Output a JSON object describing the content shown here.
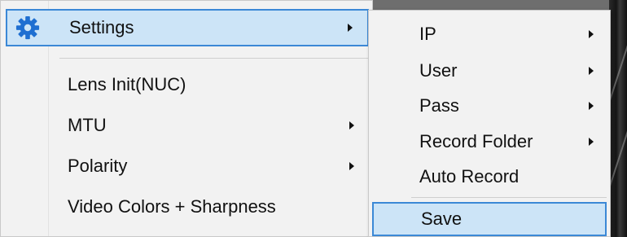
{
  "main_menu": {
    "items": [
      {
        "label": "Settings",
        "icon": "gear-icon",
        "has_submenu": true,
        "highlighted": true
      },
      {
        "label": "Lens Init(NUC)",
        "has_submenu": false
      },
      {
        "label": "MTU",
        "has_submenu": true
      },
      {
        "label": "Polarity",
        "has_submenu": true
      },
      {
        "label": "Video Colors + Sharpness",
        "has_submenu": false
      }
    ]
  },
  "settings_submenu": {
    "items": [
      {
        "label": "IP",
        "has_submenu": true
      },
      {
        "label": "User",
        "has_submenu": true
      },
      {
        "label": "Pass",
        "has_submenu": true
      },
      {
        "label": "Record Folder",
        "has_submenu": true
      },
      {
        "label": "Auto Record",
        "has_submenu": false
      },
      {
        "label": "Save",
        "has_submenu": false,
        "highlighted": true
      }
    ]
  },
  "colors": {
    "highlight_fill": "#cce4f7",
    "highlight_border": "#3b88d6",
    "menu_bg": "#f2f2f2",
    "gear_icon": "#1f6fd1"
  }
}
